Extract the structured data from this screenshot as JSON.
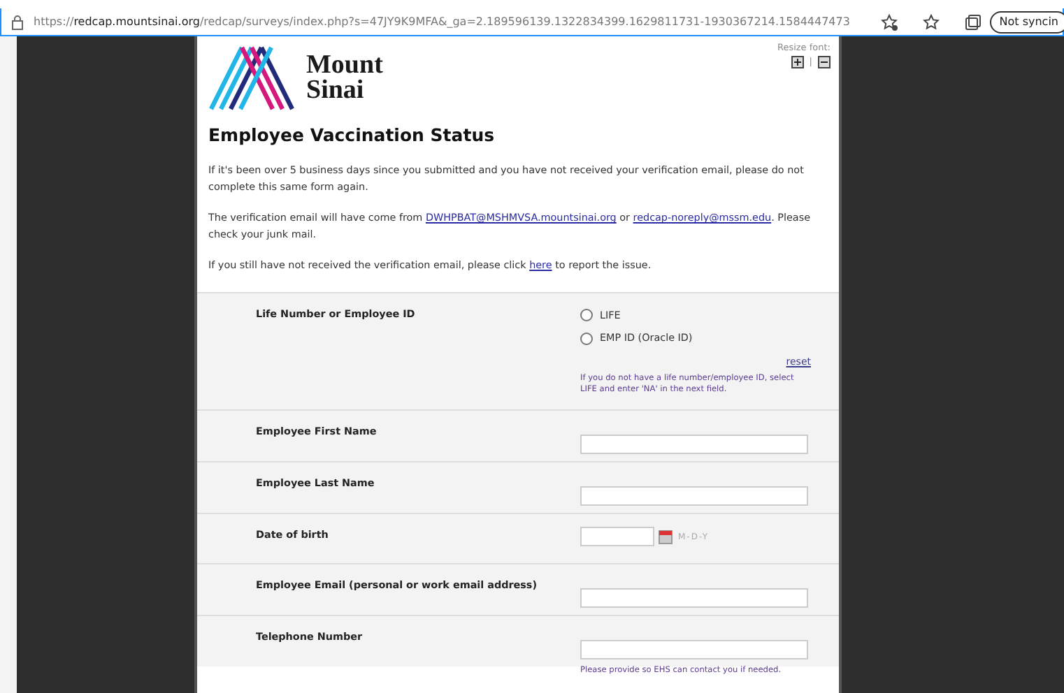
{
  "browser": {
    "url": "https://**redcap.mountsinai.org**/redcap/surveys/index.php?s=47JY9K9MFA&_ga=2.189596139.1322834399.1629811731-1930367214.1584447473",
    "sync_button": "Not syncin"
  },
  "header": {
    "logo_text": [
      "Mount",
      "Sinai"
    ],
    "resize_label": "Resize font:",
    "resize_separator": "|"
  },
  "title": "Employee Vaccination Status",
  "paragraphs": [
    {
      "parts": [
        {
          "kind": "text",
          "text": "If it's been over 5 business days since you submitted and you have not received your verification email, please do not complete this same form again."
        }
      ]
    },
    {
      "parts": [
        {
          "kind": "text",
          "text": "The verification email will have come from "
        },
        {
          "kind": "link",
          "text": "DWHPBAT@MSHMVSA.mountsinai.org"
        },
        {
          "kind": "text",
          "text": " or "
        },
        {
          "kind": "link",
          "text": "redcap-noreply@mssm.edu"
        },
        {
          "kind": "text",
          "text": ". Please check your junk mail."
        }
      ]
    },
    {
      "parts": [
        {
          "kind": "text",
          "text": "If you still have not received the verification email, please click "
        },
        {
          "kind": "link",
          "text": "here"
        },
        {
          "kind": "text",
          "text": " to report the issue."
        }
      ]
    }
  ],
  "fields": [
    {
      "kind": "radio",
      "label": "Life Number or Employee ID",
      "options": [
        {
          "label": "LIFE",
          "selected": false
        },
        {
          "label": "EMP ID (Oracle ID)",
          "selected": false
        }
      ],
      "reset": "reset",
      "note": "If you do not have a life number/employee ID, select LIFE and enter 'NA' in the next field."
    },
    {
      "kind": "text",
      "label": "Employee First Name"
    },
    {
      "kind": "text",
      "label": "Employee Last Name"
    },
    {
      "kind": "date",
      "label": "Date of birth",
      "format": "M-D-Y"
    },
    {
      "kind": "text",
      "label": "Employee Email (personal or work email address)"
    },
    {
      "kind": "text",
      "label": "Telephone Number",
      "note": "Please provide so EHS can contact you if needed."
    }
  ]
}
